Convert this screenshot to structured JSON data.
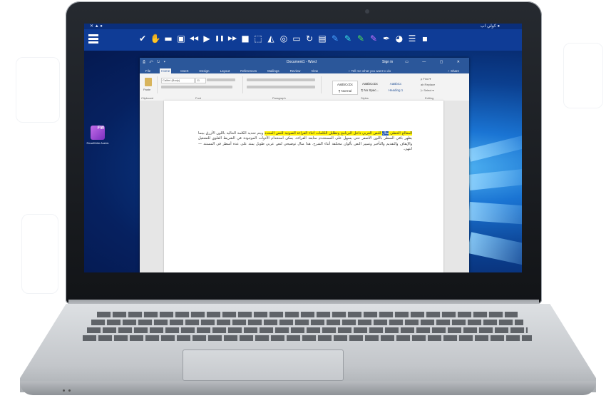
{
  "toolbar": {
    "menu_icon": "hamburger-menu-icon",
    "status_left": "✕ ▲ ●",
    "status_right": "كولي اب ●",
    "tools": [
      {
        "name": "check-icon",
        "glyph": "✔"
      },
      {
        "name": "hand-icon",
        "glyph": "✋"
      },
      {
        "name": "book-icon",
        "glyph": "▬"
      },
      {
        "name": "image-icon",
        "glyph": "▣"
      },
      {
        "name": "rewind-icon",
        "glyph": "◀◀"
      },
      {
        "name": "play-icon",
        "glyph": "▶"
      },
      {
        "name": "pause-icon",
        "glyph": "❚❚"
      },
      {
        "name": "fast-forward-icon",
        "glyph": "▶▶"
      },
      {
        "name": "stop-icon",
        "glyph": "■"
      },
      {
        "name": "select-region-icon",
        "glyph": "⬚"
      },
      {
        "name": "eraser-icon",
        "glyph": "◭"
      },
      {
        "name": "globe-icon",
        "glyph": "◎"
      },
      {
        "name": "monitor-icon",
        "glyph": "▭"
      },
      {
        "name": "refresh-icon",
        "glyph": "↻"
      },
      {
        "name": "document-icon",
        "glyph": "▤"
      },
      {
        "name": "pen-blue-icon",
        "glyph": "✎"
      },
      {
        "name": "pen-cyan-icon",
        "glyph": "✎"
      },
      {
        "name": "pen-green-icon",
        "glyph": "✎"
      },
      {
        "name": "pen-purple-icon",
        "glyph": "✎"
      },
      {
        "name": "highlighter-icon",
        "glyph": "✒"
      },
      {
        "name": "color-wheel-icon",
        "glyph": "◕"
      },
      {
        "name": "list-icon",
        "glyph": "☰"
      },
      {
        "name": "save-icon",
        "glyph": "▪"
      }
    ],
    "colors": {
      "bar": "#0f3c96",
      "pen_blue": "#4aa3ff",
      "pen_cyan": "#39e0e0",
      "pen_green": "#52e052",
      "pen_purple": "#c970ff"
    }
  },
  "desktop": {
    "icon_name": "app-shortcut-icon",
    "icon_badge": "FW",
    "icon_label": "ReadWrite Arabic"
  },
  "word": {
    "quick_access": "⎙ ↶ ↻ ▾",
    "title": "Document1 - Word",
    "sign_in": "Sign in",
    "window_controls": "▭ — ▢ ✕",
    "tabs": [
      "File",
      "Home",
      "Insert",
      "Design",
      "Layout",
      "References",
      "Mailings",
      "Review",
      "View"
    ],
    "tell_me": "♀ Tell me what you want to do",
    "share": "♂ Share",
    "ribbon": {
      "paste": "Paste",
      "font_name": "Calibri (Body)",
      "font_size": "11",
      "groups": [
        "Clipboard",
        "Font",
        "Paragraph",
        "Styles",
        "Editing"
      ],
      "styles": [
        "AaBbCcDc",
        "AaBbCcDc",
        "AaBbCc"
      ],
      "style_names": [
        "¶ Normal",
        "¶ No Spac...",
        "Heading 1"
      ],
      "editing": [
        "ρ Find ▾",
        "ab Replace",
        "▷ Select ▾"
      ]
    },
    "document": {
      "highlight_before": "المعالج الخطي",
      "selected_word": "مثال",
      "highlight_after": "للنص العربي داخل البرنامج وتظليل الكلمات أثناء القراءة الصوتية للنص المحدد",
      "rest": "ويتم تحديد الكلمة الحالية باللون الأزرق بينما يظهر باقي السطر باللون الأصفر حتى يسهل على المستخدم متابعة القراءة. يمكن استخدام الأدوات الموجودة في الشريط العلوي للتشغيل والإيقاف والتقديم والتأخير وتمييز النص بألوان مختلفة أثناء الشرح. هذا مثال توضيحي لنص عربي طويل يمتد على عدة أسطر في المستند — انتهى."
    }
  }
}
